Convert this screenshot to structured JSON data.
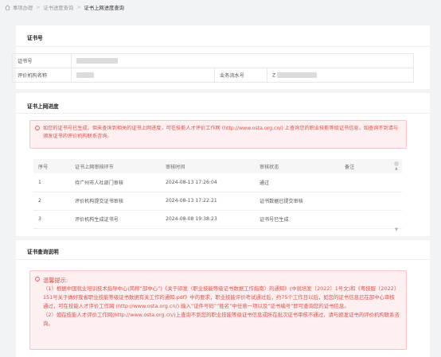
{
  "breadcrumb": {
    "items": [
      "事项办理",
      "证书进度查询",
      "证书上网进度查询"
    ]
  },
  "cert_section": {
    "title": "证书号",
    "labels": {
      "cert_no": "证书号",
      "org_name": "评价机构名称",
      "business_no": "业务流水号",
      "business_no_prefix": "Z"
    }
  },
  "progress_section": {
    "title": "证书上网进度",
    "alert": "如您的证书号已生成，但未查询到相关的证书上网进度，可在技能人才评价工作网 (http://www.osta.org.cn/) 上查询您的职业技能等级证书信息，如查询不到请与颁发证书的评价机构联系咨询。",
    "columns": [
      "序号",
      "证书上网审核环节",
      "审核时间",
      "审核状态",
      "备注"
    ],
    "rows": [
      {
        "no": "1",
        "step": "待广州市人社部门审核",
        "time": "2024-08-13 17:26:04",
        "status": "通过",
        "note": ""
      },
      {
        "no": "2",
        "step": "评价机构提交证书审核",
        "time": "2024-08-13 17:22:21",
        "status": "证书数据已提交审核",
        "note": ""
      },
      {
        "no": "3",
        "step": "评价机构生成证书号",
        "time": "2024-08-08 19:38:23",
        "status": "证书号已生成",
        "note": ""
      }
    ]
  },
  "notes_section": {
    "title": "证书查询说明",
    "heading": "温馨提示:",
    "p1": "（1）根据中国就业培训技术指导中心(简称“部中心”)《关于印发〈职业技能等级证书数据工作指南〉的通知》(中就培发〔2022〕1号文)和《粤技服〔2022〕151号关于做好我省职业技能等级证书数据有关工作的通知.pdf》中的要求，职业技能评价考试通过后，约75个工作日以后，如您的证书信息已在部中心审核通过，可在技能人才评价工作网 (http://www.osta.org.cn/) 输入“证件号码”“姓名”中任意一项以及“证书编号”即可查询您的证书信息。",
    "p2": "（2）如在技能人才评价工作网(http://www.osta.org.cn/)上查询不到您的职业技能等级证书信息或所在批次证书审核不通过，请与颁发证书的评价机构联系咨询。"
  },
  "colors": {
    "alert_text": "#d9534f",
    "alert_bg": "#fef0f0",
    "alert_border": "#fbc4c4",
    "page_bg": "#f2f3f5"
  }
}
